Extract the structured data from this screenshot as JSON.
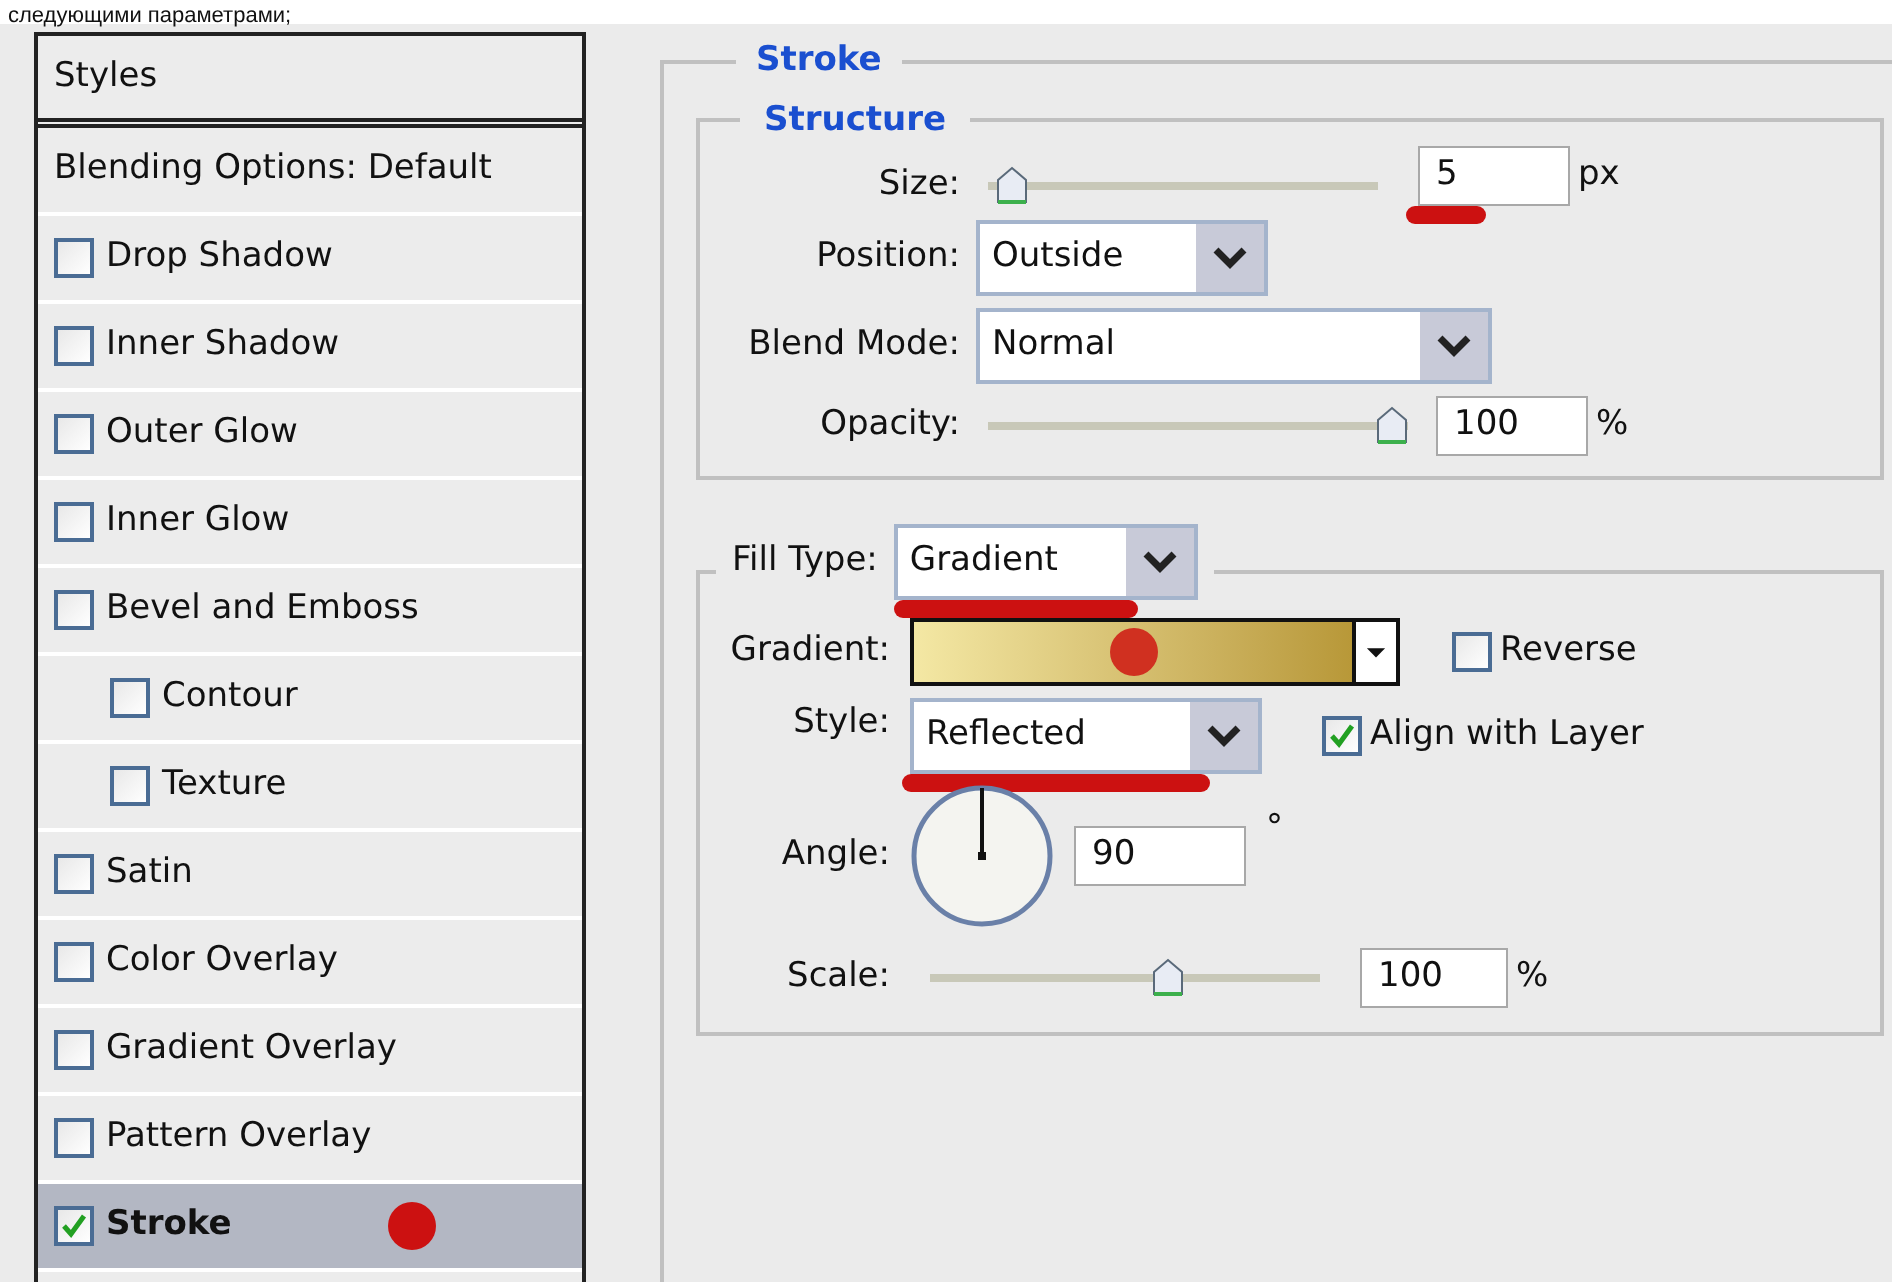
{
  "caption": "следующими параметрами;",
  "styles_panel": {
    "header": "Styles",
    "items": [
      {
        "label": "Blending Options: Default",
        "kind": "plain",
        "selected": false
      },
      {
        "label": "Drop Shadow",
        "kind": "check",
        "checked": false,
        "selected": false
      },
      {
        "label": "Inner Shadow",
        "kind": "check",
        "checked": false,
        "selected": false
      },
      {
        "label": "Outer Glow",
        "kind": "check",
        "checked": false,
        "selected": false
      },
      {
        "label": "Inner Glow",
        "kind": "check",
        "checked": false,
        "selected": false
      },
      {
        "label": "Bevel and Emboss",
        "kind": "check",
        "checked": false,
        "selected": false,
        "children": [
          {
            "label": "Contour",
            "kind": "check",
            "checked": false,
            "selected": false
          },
          {
            "label": "Texture",
            "kind": "check",
            "checked": false,
            "selected": false
          }
        ]
      },
      {
        "label": "Satin",
        "kind": "check",
        "checked": false,
        "selected": false
      },
      {
        "label": "Color Overlay",
        "kind": "check",
        "checked": false,
        "selected": false
      },
      {
        "label": "Gradient Overlay",
        "kind": "check",
        "checked": false,
        "selected": false
      },
      {
        "label": "Pattern Overlay",
        "kind": "check",
        "checked": false,
        "selected": false
      },
      {
        "label": "Stroke",
        "kind": "check",
        "checked": true,
        "selected": true
      }
    ]
  },
  "stroke": {
    "title": "Stroke",
    "structure": {
      "title": "Structure",
      "size": {
        "label": "Size:",
        "level": 0.02,
        "value": "5",
        "unit": "px"
      },
      "position": {
        "label": "Position:",
        "value": "Outside"
      },
      "blend_mode": {
        "label": "Blend Mode:",
        "value": "Normal"
      },
      "opacity": {
        "label": "Opacity:",
        "level": 1,
        "value": "100",
        "unit": "%"
      }
    },
    "fill": {
      "label": "Fill Type:",
      "value": "Gradient",
      "gradient": {
        "label": "Gradient:"
      },
      "reverse": {
        "label": "Reverse",
        "checked": false
      },
      "style": {
        "label": "Style:",
        "value": "Reflected"
      },
      "align": {
        "label": "Align with Layer",
        "checked": true
      },
      "angle": {
        "label": "Angle:",
        "value": "90",
        "unit": "°"
      },
      "scale": {
        "label": "Scale:",
        "level": 0.62,
        "value": "100",
        "unit": "%"
      }
    }
  }
}
